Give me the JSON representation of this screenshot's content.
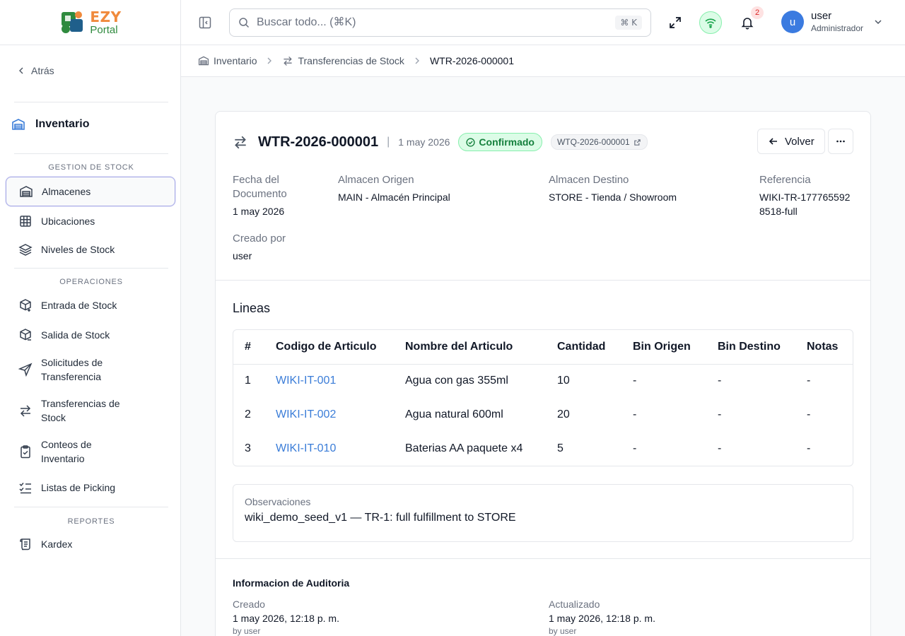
{
  "brand": {
    "line1": "EZY",
    "line2": "Portal"
  },
  "sidebar": {
    "back_label": "Atrás",
    "section_title": "Inventario",
    "groups": [
      {
        "label": "GESTION DE STOCK"
      },
      {
        "label": "OPERACIONES"
      },
      {
        "label": "REPORTES"
      }
    ],
    "items": [
      {
        "label": "Almacenes",
        "icon": "warehouse-icon",
        "active": true
      },
      {
        "label": "Ubicaciones",
        "icon": "grid-icon"
      },
      {
        "label": "Niveles de Stock",
        "icon": "layers-icon"
      },
      {
        "label": "Entrada de Stock",
        "icon": "package-plus-icon"
      },
      {
        "label": "Salida de Stock",
        "icon": "package-out-icon"
      },
      {
        "label": "Solicitudes de Transferencia",
        "icon": "send-icon"
      },
      {
        "label": "Transferencias de Stock",
        "icon": "arrows-left-right-icon"
      },
      {
        "label": "Conteos de Inventario",
        "icon": "clipboard-check-icon"
      },
      {
        "label": "Listas de Picking",
        "icon": "list-checks-icon"
      },
      {
        "label": "Kardex",
        "icon": "scroll-icon"
      }
    ]
  },
  "topbar": {
    "search_placeholder": "Buscar todo... (⌘K)",
    "search_shortcut": "⌘ K",
    "notification_count": "2",
    "user_initial": "u",
    "user_name": "user",
    "user_role": "Administrador"
  },
  "breadcrumb": [
    {
      "label": "Inventario",
      "icon": "warehouse-icon"
    },
    {
      "label": "Transferencias de Stock",
      "icon": "arrows-left-right-icon"
    },
    {
      "label": "WTR-2026-000001"
    }
  ],
  "document": {
    "id": "WTR-2026-000001",
    "date": "1 may 2026",
    "status": "Confirmado",
    "request_ref": "WTQ-2026-000001",
    "back_button": "Volver",
    "fields": {
      "doc_date_label": "Fecha del Documento",
      "doc_date_value": "1 may 2026",
      "origin_label": "Almacen Origen",
      "origin_value": "MAIN - Almacén Principal",
      "dest_label": "Almacen Destino",
      "dest_value": "STORE - Tienda / Showroom",
      "ref_label": "Referencia",
      "ref_value": "WIKI-TR-1777655928518-full",
      "created_by_label": "Creado por",
      "created_by_value": "user"
    }
  },
  "lines": {
    "title": "Lineas",
    "columns": [
      "#",
      "Codigo de Articulo",
      "Nombre del Articulo",
      "Cantidad",
      "Bin Origen",
      "Bin Destino",
      "Notas"
    ],
    "rows": [
      {
        "num": "1",
        "code": "WIKI-IT-001",
        "name": "Agua con gas 355ml",
        "qty": "10",
        "bin_from": "-",
        "bin_to": "-",
        "notes": "-"
      },
      {
        "num": "2",
        "code": "WIKI-IT-002",
        "name": "Agua natural 600ml",
        "qty": "20",
        "bin_from": "-",
        "bin_to": "-",
        "notes": "-"
      },
      {
        "num": "3",
        "code": "WIKI-IT-010",
        "name": "Baterias AA paquete x4",
        "qty": "5",
        "bin_from": "-",
        "bin_to": "-",
        "notes": "-"
      }
    ]
  },
  "observations": {
    "label": "Observaciones",
    "value": "wiki_demo_seed_v1 — TR-1: full fulfillment to STORE"
  },
  "audit": {
    "title": "Informacion de Auditoria",
    "created_label": "Creado",
    "created_value": "1 may 2026, 12:18 p. m.",
    "created_by": "by user",
    "updated_label": "Actualizado",
    "updated_value": "1 may 2026, 12:18 p. m.",
    "updated_by": "by user"
  },
  "colors": {
    "accent": "#3b7dd8",
    "status_green": "#15803d",
    "status_green_bg": "#dcfce7",
    "active_border": "#a5a8e6"
  }
}
